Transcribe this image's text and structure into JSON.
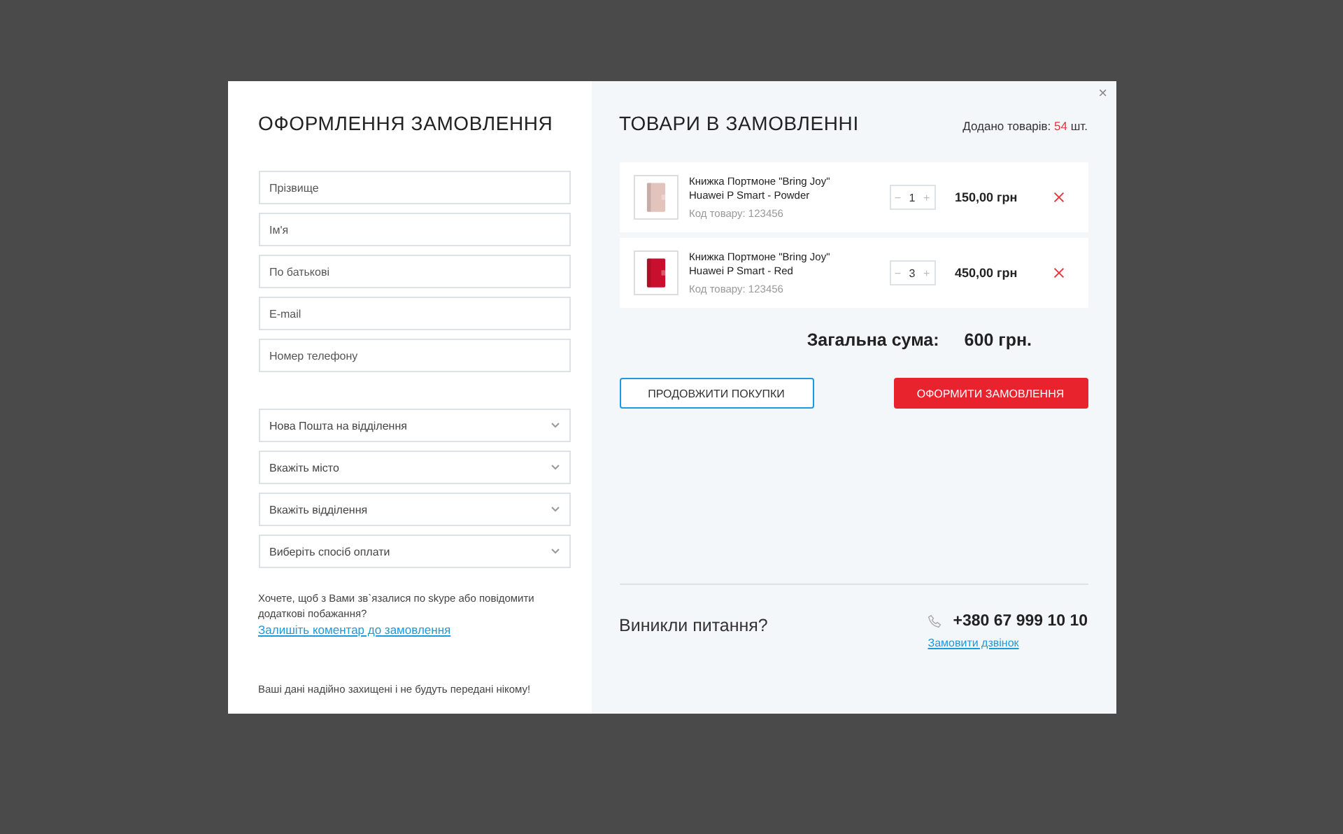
{
  "checkout": {
    "title": "ОФОРМЛЕННЯ ЗАМОВЛЕННЯ",
    "fields": [
      {
        "placeholder": "Прізвище"
      },
      {
        "placeholder": "Ім'я"
      },
      {
        "placeholder": "По батькові"
      },
      {
        "placeholder": "E-mail"
      },
      {
        "placeholder": "Номер телефону"
      }
    ],
    "selects": [
      {
        "value": "Нова Пошта на відділення"
      },
      {
        "value": "Вкажіть місто"
      },
      {
        "value": "Вкажіть відділення"
      },
      {
        "value": "Виберіть спосіб оплати"
      }
    ],
    "comment_prompt": "Хочете, щоб з Вами зв`язалися по skype або повідомити додаткові побажання?",
    "comment_link": "Залишіть коментар до замовлення",
    "privacy_note": "Ваші дані надійно захищені і не будуть передані нікому!"
  },
  "cart": {
    "title": "ТОВАРИ В ЗАМОВЛЕННІ",
    "added_label": "Додано товарів:",
    "added_count": "54",
    "added_unit": "шт.",
    "items": [
      {
        "name": "Книжка Портмоне \"Bring Joy\" Huawei P Smart - Powder",
        "code": "Код товару: 123456",
        "minus": "−",
        "qty": "1",
        "plus": "+",
        "price": "150,00 грн",
        "color": "#e2c4bd"
      },
      {
        "name": "Книжка Портмоне \"Bring Joy\" Huawei P Smart - Red",
        "code": "Код товару: 123456",
        "minus": "−",
        "qty": "3",
        "plus": "+",
        "price": "450,00 грн",
        "color": "#c8102e"
      }
    ],
    "total_label": "Загальна сума:",
    "total_value": "600 грн.",
    "continue_button": "ПРОДОВЖИТИ ПОКУПКИ",
    "checkout_button": "ОФОРМИТИ ЗАМОВЛЕННЯ",
    "question": "Виникли питання?",
    "phone": "+380 67 999 10 10",
    "callback_link": "Замовити дзвінок",
    "close": "×"
  }
}
